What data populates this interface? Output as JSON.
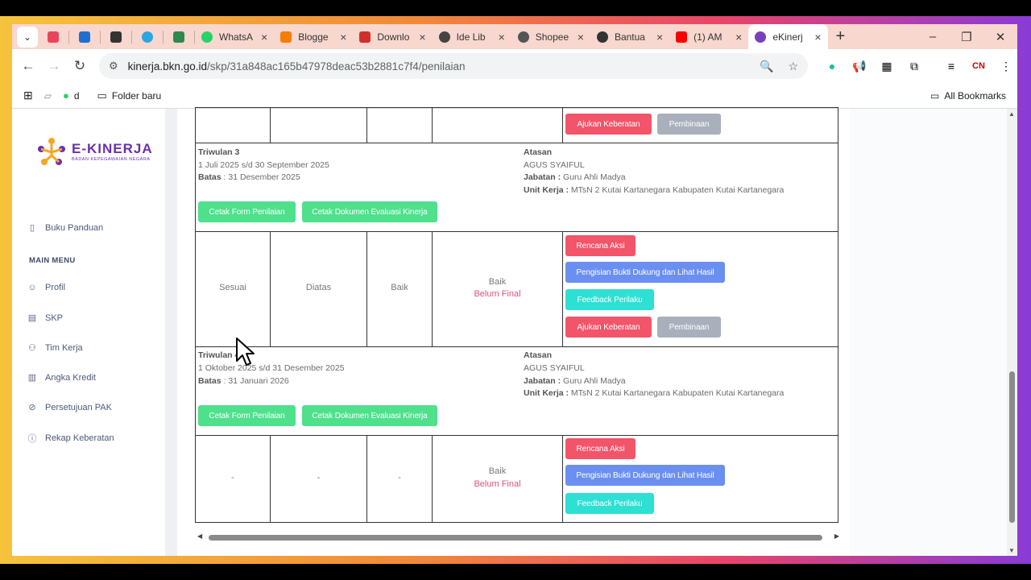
{
  "browser": {
    "tabs": [
      {
        "label": "",
        "color": "#e8455a"
      },
      {
        "label": "",
        "color": "#1f6fd1"
      },
      {
        "label": "",
        "color": "#333333"
      },
      {
        "label": "",
        "color": "#2aa7e0"
      },
      {
        "label": "",
        "color": "#2d8a4a"
      },
      {
        "label": "WhatsA",
        "color": "#25d366"
      },
      {
        "label": "Blogge",
        "color": "#f57d00"
      },
      {
        "label": "Downlo",
        "color": "#d0302a"
      },
      {
        "label": "Ide Lib",
        "color": "#444444"
      },
      {
        "label": "Shopee",
        "color": "#555555"
      },
      {
        "label": "Bantua",
        "color": "#333333"
      },
      {
        "label": "(1) AM",
        "color": "#ff0000"
      },
      {
        "label": "eKinerj",
        "color": "#7a3fc0"
      }
    ],
    "url_host": "kinerja.bkn.go.id",
    "url_path": "/skp/31a848ac165b47978deac53b2881c7f4/penilaian",
    "bookmarks": [
      "d",
      "Folder baru"
    ],
    "all_bookmarks": "All Bookmarks"
  },
  "sidebar": {
    "logo_title": "E-KINERJA",
    "logo_sub": "BADAN KEPEGAWAIAN NEGARA",
    "buku_panduan": "Buku Panduan",
    "main_menu": "MAIN MENU",
    "items": [
      "Profil",
      "SKP",
      "Tim Kerja",
      "Angka Kredit",
      "Persetujuan PAK",
      "Rekap Keberatan"
    ]
  },
  "top_row": {
    "ajukan": "Ajukan Keberatan",
    "pembinaan": "Pembinaan"
  },
  "periods": [
    {
      "title": "Triwulan 3",
      "range": "1 Juli 2025 s/d 30 September 2025",
      "batas_label": "Batas",
      "batas": " : 31 Desember 2025",
      "atasan_label": "Atasan",
      "atasan": "AGUS SYAIFUL",
      "jabatan_label": "Jabatan :",
      "jabatan": " Guru Ahli Madya",
      "unit_label": "Unit Kerja :",
      "unit": " MTsN 2 Kutai Kartanegara Kabupaten Kutai Kartanegara",
      "cetak_form": "Cetak Form Penilaian",
      "cetak_dok": "Cetak Dokumen Evaluasi Kinerja",
      "c1": "Sesuai",
      "c2": "Diatas",
      "c3": "Baik",
      "c4a": "Baik",
      "c4b": "Belum Final",
      "rencana": "Rencana Aksi",
      "pengisian": "Pengisian Bukti Dukung dan Lihat Hasil",
      "feedback": "Feedback Perilaku",
      "ajukan": "Ajukan Keberatan",
      "pembinaan": "Pembinaan"
    },
    {
      "title": "Triwulan 4",
      "range": "1 Oktober 2025 s/d 31 Desember 2025",
      "batas_label": "Batas",
      "batas": " : 31 Januari 2026",
      "atasan_label": "Atasan",
      "atasan": "AGUS SYAIFUL",
      "jabatan_label": "Jabatan :",
      "jabatan": " Guru Ahli Madya",
      "unit_label": "Unit Kerja :",
      "unit": " MTsN 2 Kutai Kartanegara Kabupaten Kutai Kartanegara",
      "cetak_form": "Cetak Form Penilaian",
      "cetak_dok": "Cetak Dokumen Evaluasi Kinerja",
      "c1": "-",
      "c2": "-",
      "c3": "-",
      "c4a": "Baik",
      "c4b": "Belum Final",
      "rencana": "Rencana Aksi",
      "pengisian": "Pengisian Bukti Dukung dan Lihat Hasil",
      "feedback": "Feedback Perilaku"
    }
  ]
}
